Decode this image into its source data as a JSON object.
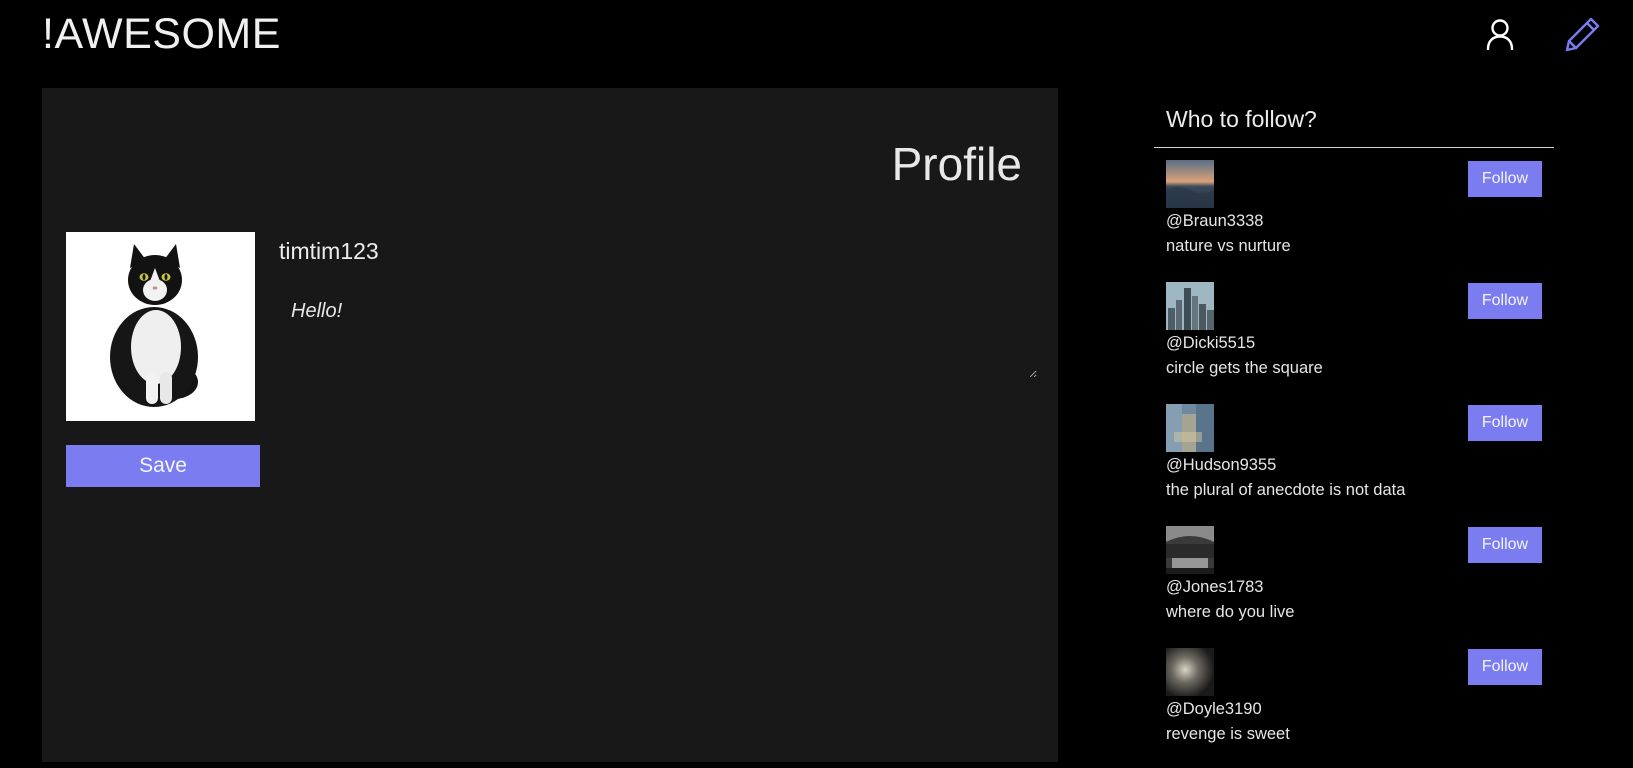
{
  "header": {
    "logo": "!AWESOME",
    "icons": {
      "profile": "user-icon",
      "compose": "pencil-icon"
    }
  },
  "colors": {
    "background": "#000000",
    "panel": "#181818",
    "accent": "#7a7cf0",
    "text": "#e6e6e6"
  },
  "profile": {
    "title": "Profile",
    "username": "timtim123",
    "bio_value": "",
    "bio_placeholder": "Hello!",
    "avatar_icon": "cat-photo",
    "save_label": "Save"
  },
  "sidebar": {
    "title": "Who to follow?",
    "items": [
      {
        "handle": "@Braun3338",
        "bio": "nature vs nurture",
        "button": "Follow",
        "thumb": "sunset-sea-photo"
      },
      {
        "handle": "@Dicki5515",
        "bio": "circle gets the square",
        "button": "Follow",
        "thumb": "city-skyline-photo"
      },
      {
        "handle": "@Hudson9355",
        "bio": "the plural of anecdote is not data",
        "button": "Follow",
        "thumb": "blurred-street-photo"
      },
      {
        "handle": "@Jones1783",
        "bio": "where do you live",
        "button": "Follow",
        "thumb": "station-interior-photo"
      },
      {
        "handle": "@Doyle3190",
        "bio": "revenge is sweet",
        "button": "Follow",
        "thumb": "dark-blur-photo"
      }
    ]
  }
}
